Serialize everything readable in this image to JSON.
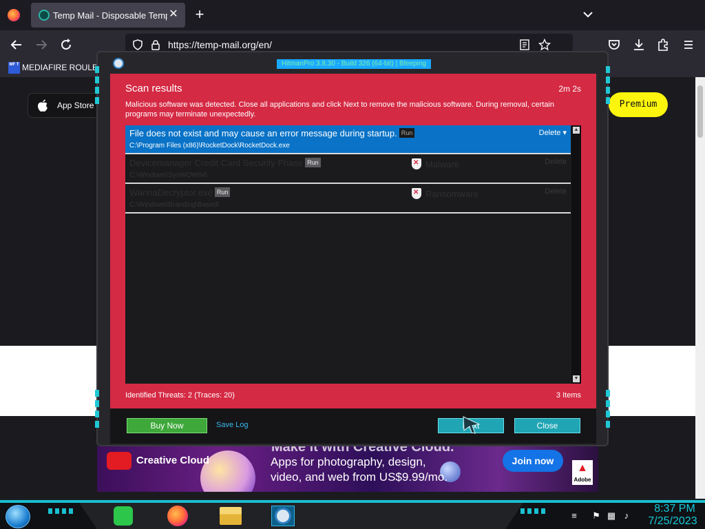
{
  "browser": {
    "tab_title": "Temp Mail - Disposable Tempo",
    "tab_close": "✕",
    "new_tab": "+",
    "url": "https://temp-mail.org/en/",
    "bookmark_label": "MEDIAFIRE ROULETTE",
    "bookmark_icon_text": "MF T"
  },
  "page": {
    "app_store_label": "App Store",
    "premium_label": "Premium"
  },
  "ad": {
    "brand": "Creative Cloud",
    "headline": "Make it with Creative Cloud.",
    "copy": "Apps for photography, design, video, and web from US$9.99/mo.",
    "cta": "Join now",
    "logo_text": "Adobe",
    "colors": {
      "cta": "#1473e6",
      "brand_red": "#e31b23"
    }
  },
  "hitmanpro": {
    "title": "HitmanPro 3.8.30 - Build 326 (64-bit) | Bleeping",
    "scan_title": "Scan results",
    "elapsed": "2m 2s",
    "message": "Malicious software was detected. Close all applications and click Next to remove the malicious software. During removal, certain programs may terminate unexpectedly.",
    "results": [
      {
        "name": "File does not exist and may cause an error message during startup.",
        "badge": "Run",
        "path": "C:\\Program Files (x86)\\RocketDock\\RocketDock.exe",
        "threat": "",
        "action": "Delete ▾"
      },
      {
        "name": "Devicemanager Credit Card Security Phase",
        "badge": "Run",
        "path": "C:\\Windows\\SysWOW64\\",
        "threat": "Malware",
        "action": "Delete"
      },
      {
        "name": "WannaDecryptor.exe",
        "badge": "Run",
        "path": "C:\\Windows\\Branding\\Based\\",
        "threat": "Ransomware",
        "action": "Delete"
      }
    ],
    "identified": "Identified Threats: 2   (Traces: 20)",
    "items": "3 Items",
    "buy_now": "Buy Now",
    "save_log": "Save Log",
    "next": "Next",
    "close": "Close",
    "colors": {
      "panel": "#d52a44",
      "selected_row": "#0a73c7",
      "buttons": "#1fa5b4",
      "buy": "#3ea83a"
    }
  },
  "taskbar": {
    "time": "8:37 PM",
    "date": "7/25/2023",
    "apps": [
      "notes-icon",
      "firefox-icon",
      "file-explorer-icon",
      "hitmanpro-icon"
    ],
    "accent": "#19bfd0"
  }
}
